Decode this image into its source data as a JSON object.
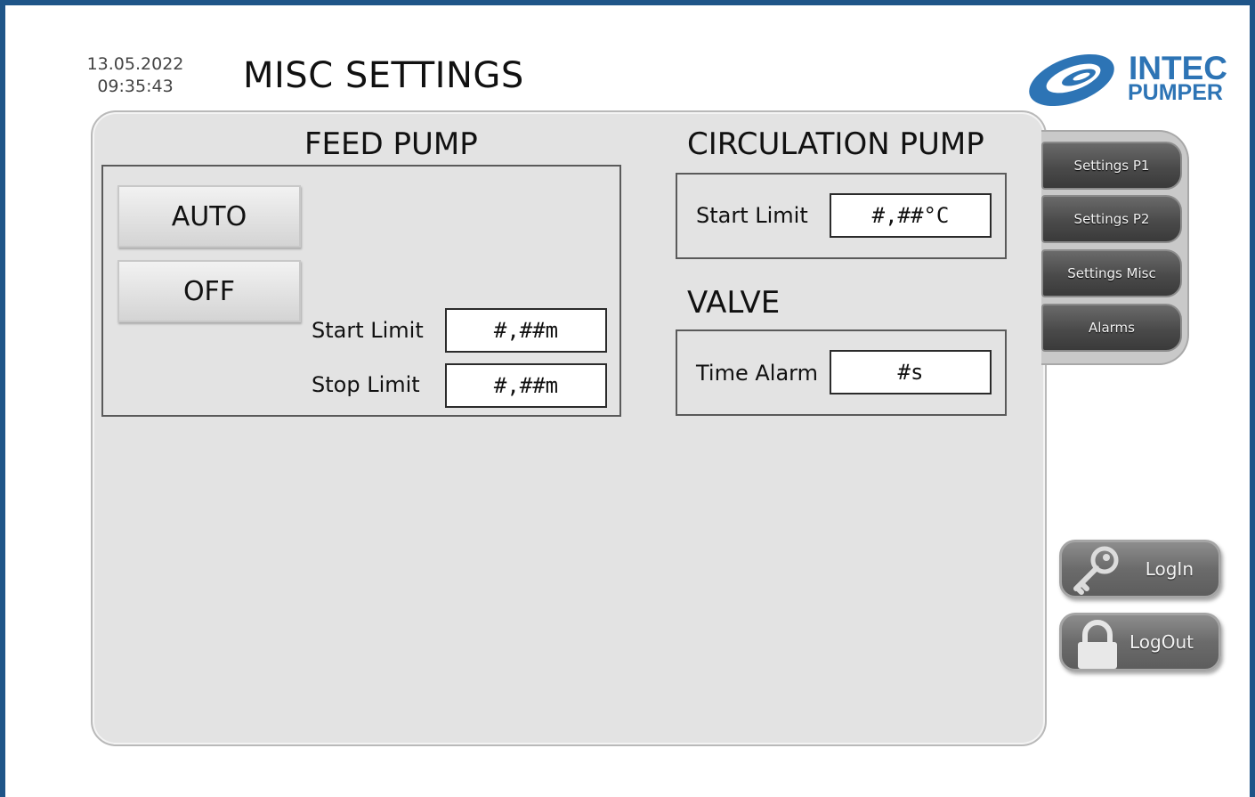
{
  "header": {
    "date": "13.05.2022",
    "time": "09:35:43",
    "title": "MISC SETTINGS"
  },
  "logo": {
    "line1": "INTEC",
    "line2": "PUMPER",
    "color": "#2d74b5"
  },
  "feed_pump": {
    "title": "FEED PUMP",
    "auto_label": "AUTO",
    "off_label": "OFF",
    "start_limit_label": "Start Limit",
    "start_limit_value": "#,##m",
    "stop_limit_label": "Stop Limit",
    "stop_limit_value": "#,##m"
  },
  "circulation_pump": {
    "title": "CIRCULATION PUMP",
    "start_limit_label": "Start Limit",
    "start_limit_value": "#,##°C"
  },
  "valve": {
    "title": "VALVE",
    "time_alarm_label": "Time Alarm",
    "time_alarm_value": "#s"
  },
  "nav": {
    "items": [
      {
        "label": "Settings P1"
      },
      {
        "label": "Settings P2"
      },
      {
        "label": "Settings Misc"
      },
      {
        "label": "Alarms"
      }
    ]
  },
  "auth": {
    "login_label": "LogIn",
    "logout_label": "LogOut",
    "login_icon": "key-icon",
    "logout_icon": "padlock-icon"
  },
  "colors": {
    "frame": "#1f5588",
    "panel": "#e3e3e3",
    "nav_button": "#4a4a4a",
    "side_button": "#6b6b6b"
  }
}
